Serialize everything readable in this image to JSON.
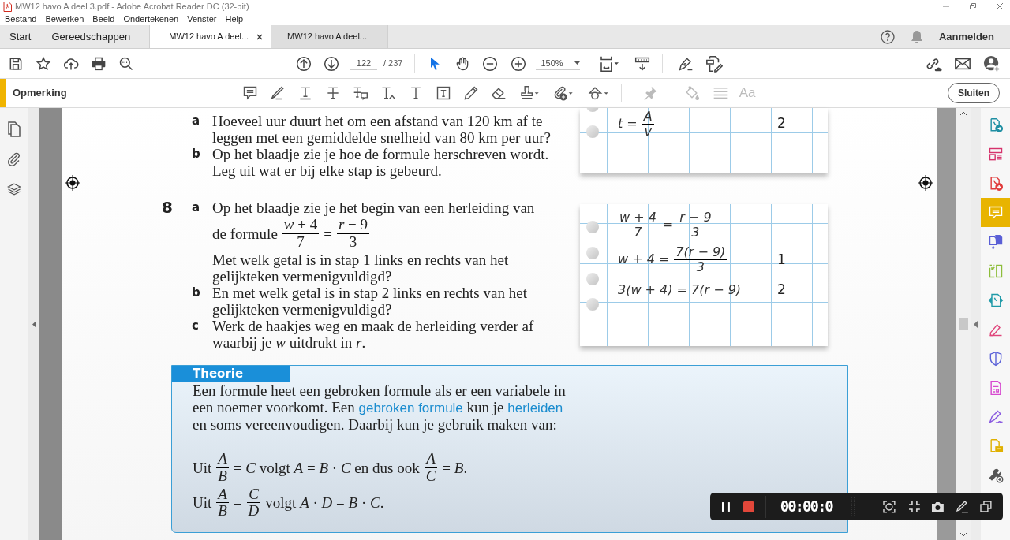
{
  "window": {
    "title": "MW12 havo A deel 3.pdf - Adobe Acrobat Reader DC (32-bit)"
  },
  "menu": [
    "Bestand",
    "Bewerken",
    "Beeld",
    "Ondertekenen",
    "Venster",
    "Help"
  ],
  "tabs": [
    {
      "label": "Start",
      "kind": "nav",
      "selected": false
    },
    {
      "label": "Gereedschappen",
      "kind": "nav",
      "selected": false
    },
    {
      "label": "MW12 havo A deel...",
      "kind": "document",
      "selected": true
    },
    {
      "label": "MW12 havo A deel...",
      "kind": "document",
      "selected": false
    }
  ],
  "account": {
    "sign_in": "Aanmelden"
  },
  "toolbar": {
    "page": "122",
    "page_total": "/ 237",
    "zoom": "150%"
  },
  "comment_toolbar": {
    "title": "Opmerking",
    "font_button": "Aa",
    "close": "Sluiten"
  },
  "document": {
    "exercise_7": {
      "parts": [
        {
          "letter": "a",
          "text": "Hoeveel uur duurt het om een afstand van 120 km af te leggen met een gemiddelde snelheid van 80 km per uur?"
        },
        {
          "letter": "b",
          "text": "Op het blaadje zie je hoe de formule herschreven wordt. Leg uit wat er bij elke stap is gebeurd."
        }
      ]
    },
    "exercise_8": {
      "number": "8",
      "parts": [
        {
          "letter": "a",
          "intro": "Op het blaadje zie je het begin van een herleiding van",
          "formula": [
            {
              "kind": "text",
              "text": "de formule"
            },
            {
              "kind": "frac",
              "num": "*w* + 4",
              "den": "7"
            },
            {
              "kind": "text",
              "text": "="
            },
            {
              "kind": "frac",
              "num": "*r* − 9",
              "den": "3"
            }
          ],
          "text": "Met welk getal is in stap 1 links en rechts van het gelijkteken vermenigvuldigd?"
        },
        {
          "letter": "b",
          "text": "En met welk getal is in stap 2 links en rechts van het gelijkteken vermenigvuldigd?"
        },
        {
          "letter": "c",
          "text": "Werk de haakjes weg en maak de herleiding verder af waarbij je *w* uitdrukt in *r*."
        }
      ]
    },
    "notebooks": [
      {
        "rows": [
          {
            "equation": [
              {
                "kind": "text",
                "text": "t ="
              },
              {
                "kind": "frac",
                "num": "A",
                "den": "v"
              }
            ],
            "step": "2"
          }
        ]
      },
      {
        "rows": [
          {
            "equation": [
              {
                "kind": "frac",
                "num": "w + 4",
                "den": "7"
              },
              {
                "kind": "text",
                "text": "="
              },
              {
                "kind": "frac",
                "num": "r − 9",
                "den": "3"
              }
            ]
          },
          {
            "equation": [
              {
                "kind": "text",
                "text": "w + 4 ="
              },
              {
                "kind": "frac",
                "num": "7(r − 9)",
                "den": "3"
              }
            ],
            "step": "1"
          },
          {
            "equation": [
              {
                "kind": "text",
                "text": "3(w + 4) = 7(r − 9)"
              }
            ],
            "step": "2"
          }
        ]
      }
    ],
    "theory": {
      "title": "Theorie",
      "paragraph": [
        {
          "kind": "plain",
          "text": "Een formule heet een gebroken formule als er een variabele in een noemer voorkomt. Een "
        },
        {
          "kind": "term",
          "text": "gebroken formule"
        },
        {
          "kind": "plain",
          "text": " kun je "
        },
        {
          "kind": "term",
          "text": "herleiden"
        },
        {
          "kind": "plain",
          "text": " en soms vereenvoudigen. Daarbij kun je gebruik maken van:"
        }
      ],
      "rules": [
        [
          {
            "kind": "text",
            "text": "Uit"
          },
          {
            "kind": "frac",
            "num": "*A*",
            "den": "*B*"
          },
          {
            "kind": "text",
            "text": "= *C* volgt *A* = *B* · *C* en dus ook"
          },
          {
            "kind": "frac",
            "num": "*A*",
            "den": "*C*"
          },
          {
            "kind": "text",
            "text": "= *B*."
          }
        ],
        [
          {
            "kind": "text",
            "text": "Uit"
          },
          {
            "kind": "frac",
            "num": "*A*",
            "den": "*B*"
          },
          {
            "kind": "text",
            "text": "="
          },
          {
            "kind": "frac",
            "num": "*C*",
            "den": "*D*"
          },
          {
            "kind": "text",
            "text": "volgt *A* · *D* = *B* · *C*."
          }
        ]
      ]
    }
  },
  "tools_panel": [
    {
      "kind": "export",
      "selected": false
    },
    {
      "kind": "organize",
      "selected": false
    },
    {
      "kind": "create",
      "selected": false
    },
    {
      "kind": "comment",
      "selected": true
    },
    {
      "kind": "combine",
      "selected": false
    },
    {
      "kind": "compress",
      "selected": false
    },
    {
      "kind": "convert",
      "selected": false
    },
    {
      "kind": "edit",
      "selected": false
    },
    {
      "kind": "protect",
      "selected": false
    },
    {
      "kind": "forms",
      "selected": false
    },
    {
      "kind": "sign",
      "selected": false
    },
    {
      "kind": "send",
      "selected": false
    },
    {
      "kind": "more",
      "selected": false
    }
  ],
  "recorder": {
    "time": "00:00:0"
  }
}
